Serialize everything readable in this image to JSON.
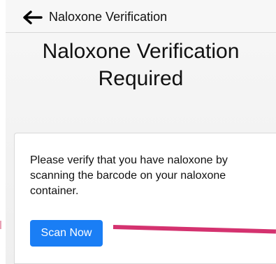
{
  "window": {
    "nav_title": "Naloxone Verification",
    "back_icon": "arrow-left-icon"
  },
  "main": {
    "title": "Naloxone Verification Required",
    "card": {
      "message": "Please verify that you have naloxone by scanning the barcode on your naloxone container.",
      "scan_button_label": "Scan Now"
    }
  },
  "colors": {
    "button_bg": "#1a7ef5",
    "button_text": "#ffffff",
    "annotation_arrow": "#d4326f",
    "background": "#f7f7f7"
  }
}
